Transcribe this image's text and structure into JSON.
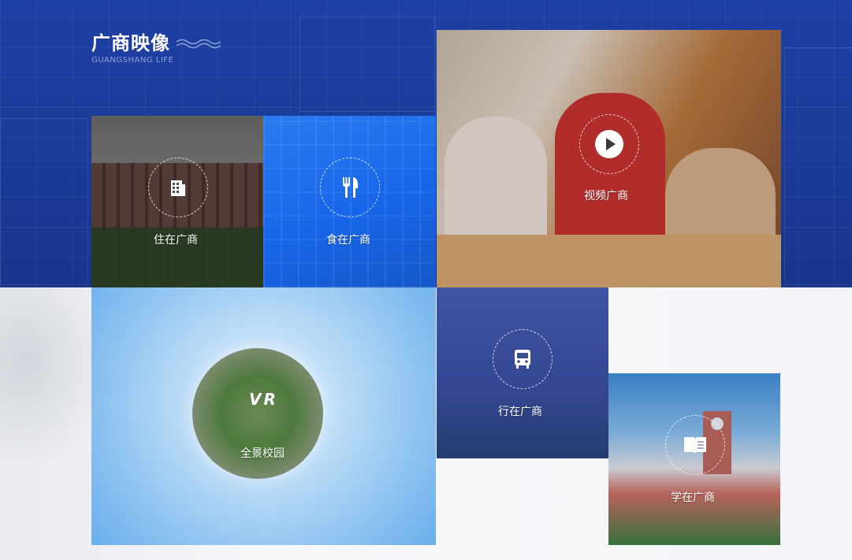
{
  "section": {
    "title": "广商映像",
    "subtitle": "GUANGSHANG LIFE"
  },
  "tiles": [
    {
      "label": "住在广商",
      "icon": "building-icon"
    },
    {
      "label": "食在广商",
      "icon": "fork-knife-icon"
    },
    {
      "label": "视频广商",
      "icon": "play-icon"
    },
    {
      "label": "全景校园",
      "icon": "vr-globe-icon",
      "badge": "VR"
    },
    {
      "label": "行在广商",
      "icon": "bus-icon"
    },
    {
      "label": "学在广商",
      "icon": "book-icon"
    }
  ],
  "colors": {
    "header_bg": "#1e3fa4",
    "food_tile": "#1766ea",
    "text": "#ffffff"
  }
}
